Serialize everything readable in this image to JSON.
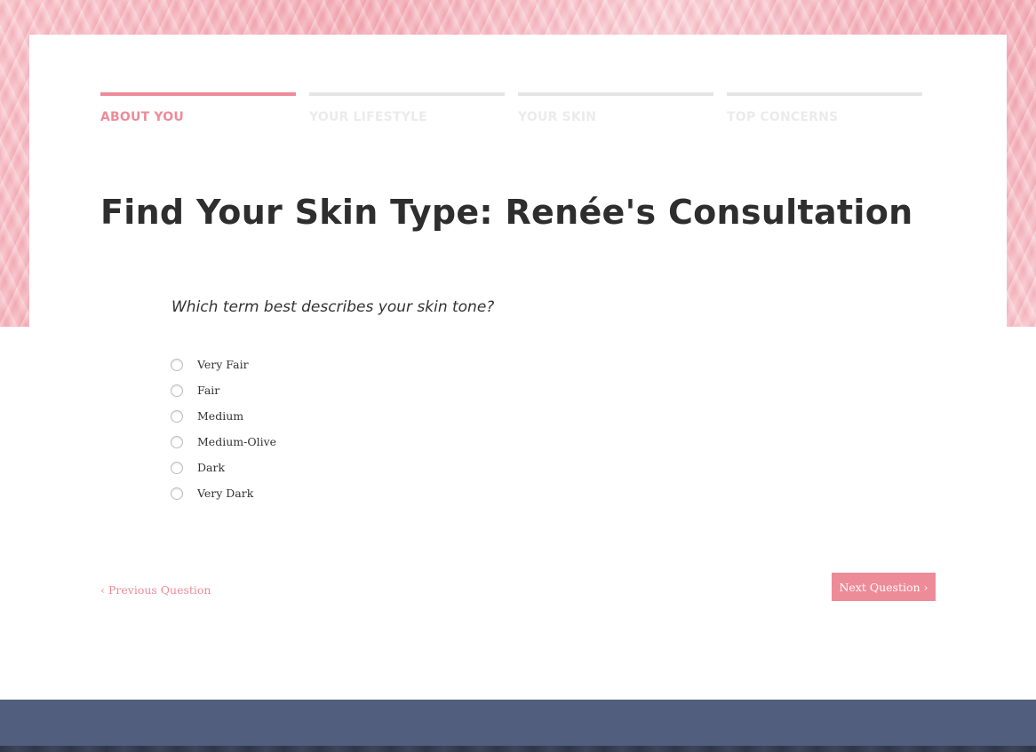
{
  "progress": {
    "steps": [
      {
        "label": "ABOUT YOU",
        "active": true
      },
      {
        "label": "YOUR LIFESTYLE",
        "active": false
      },
      {
        "label": "YOUR SKIN",
        "active": false
      },
      {
        "label": "TOP CONCERNS",
        "active": false
      }
    ]
  },
  "page_title": "Find Your Skin Type: Renée's Consultation",
  "question": {
    "text": "Which term best describes your skin tone?",
    "options": [
      "Very Fair",
      "Fair",
      "Medium",
      "Medium-Olive",
      "Dark",
      "Very Dark"
    ],
    "selected": null
  },
  "navigation": {
    "prev_label": "‹ Previous Question",
    "next_label": "Next Question ›"
  },
  "colors": {
    "accent": "#ee8b98",
    "footer": "#525e7d"
  }
}
